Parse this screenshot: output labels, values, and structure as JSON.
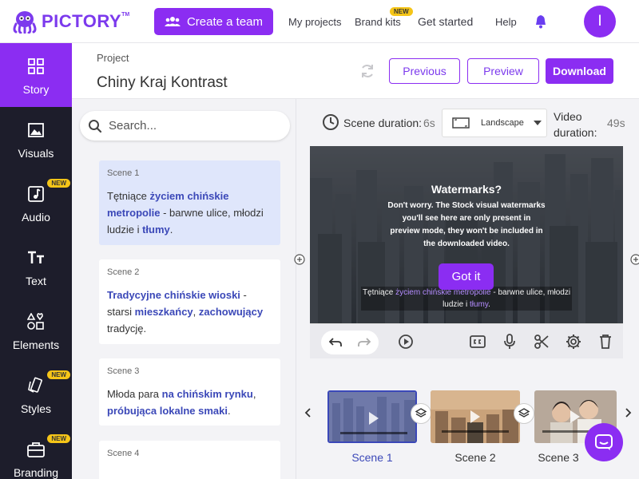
{
  "app": {
    "logo_text": "PICTORY",
    "logo_tm": "TM"
  },
  "topbar": {
    "create_team": "Create a team",
    "links": [
      "My projects",
      "Brand kits",
      "Get started",
      "Help"
    ],
    "new_badge": "NEW",
    "avatar_initial": "I"
  },
  "sidebar": {
    "items": [
      {
        "label": "Story",
        "icon": "story-icon",
        "active": true,
        "badge": ""
      },
      {
        "label": "Visuals",
        "icon": "image-icon",
        "active": false,
        "badge": ""
      },
      {
        "label": "Audio",
        "icon": "music-icon",
        "active": false,
        "badge": "NEW"
      },
      {
        "label": "Text",
        "icon": "text-icon",
        "active": false,
        "badge": ""
      },
      {
        "label": "Elements",
        "icon": "elements-icon",
        "active": false,
        "badge": ""
      },
      {
        "label": "Styles",
        "icon": "styles-icon",
        "active": false,
        "badge": "NEW"
      },
      {
        "label": "Branding",
        "icon": "branding-icon",
        "active": false,
        "badge": "NEW"
      }
    ]
  },
  "project": {
    "label": "Project",
    "title": "Chiny Kraj Kontrast",
    "previous": "Previous",
    "preview": "Preview",
    "download": "Download"
  },
  "search": {
    "placeholder": "Search..."
  },
  "scenes": [
    {
      "label": "Scene 1",
      "parts": [
        [
          "Tętniące ",
          false
        ],
        [
          "życiem chińskie metropolie",
          true
        ],
        [
          " - barwne ulice, młodzi ludzie i ",
          false
        ],
        [
          "tłumy",
          true
        ],
        [
          ".",
          false
        ]
      ]
    },
    {
      "label": "Scene 2",
      "parts": [
        [
          "Tradycyjne chińskie wioski",
          true
        ],
        [
          " - starsi ",
          false
        ],
        [
          "mieszkańcy",
          true
        ],
        [
          ", ",
          false
        ],
        [
          "zachowujący",
          true
        ],
        [
          " tradycję.",
          false
        ]
      ]
    },
    {
      "label": "Scene 3",
      "parts": [
        [
          "Młoda para ",
          false
        ],
        [
          "na chińskim rynku",
          true
        ],
        [
          ", ",
          false
        ],
        [
          "próbująca lokalne smaki",
          true
        ],
        [
          ".",
          false
        ]
      ]
    },
    {
      "label": "Scene 4",
      "parts": []
    }
  ],
  "preview": {
    "scene_duration_label": "Scene duration:",
    "scene_duration": "6s",
    "orientation": "Landscape",
    "video_duration_label_1": "Video",
    "video_duration_label_2": "duration:",
    "video_duration": "49s",
    "wm_title": "Watermarks?",
    "wm_body": "Don't worry. The Stock visual watermarks you'll see here are only present in preview mode, they won't be included in the downloaded video.",
    "got_it": "Got it",
    "caption_parts": [
      [
        "Tętniące ",
        false
      ],
      [
        "życiem chińskie metropolie",
        true
      ],
      [
        " - barwne ulice, młodzi ludzie i ",
        false
      ],
      [
        "tłumy",
        true
      ],
      [
        ".",
        false
      ]
    ]
  },
  "timeline": {
    "thumbs": [
      {
        "label": "Scene 1",
        "active": true
      },
      {
        "label": "Scene 2",
        "active": false
      },
      {
        "label": "Scene 3",
        "active": false
      }
    ]
  },
  "colors": {
    "accent": "#8b2df2",
    "sidebar_bg": "#1d1d2b",
    "highlight": "#3b48b8"
  }
}
